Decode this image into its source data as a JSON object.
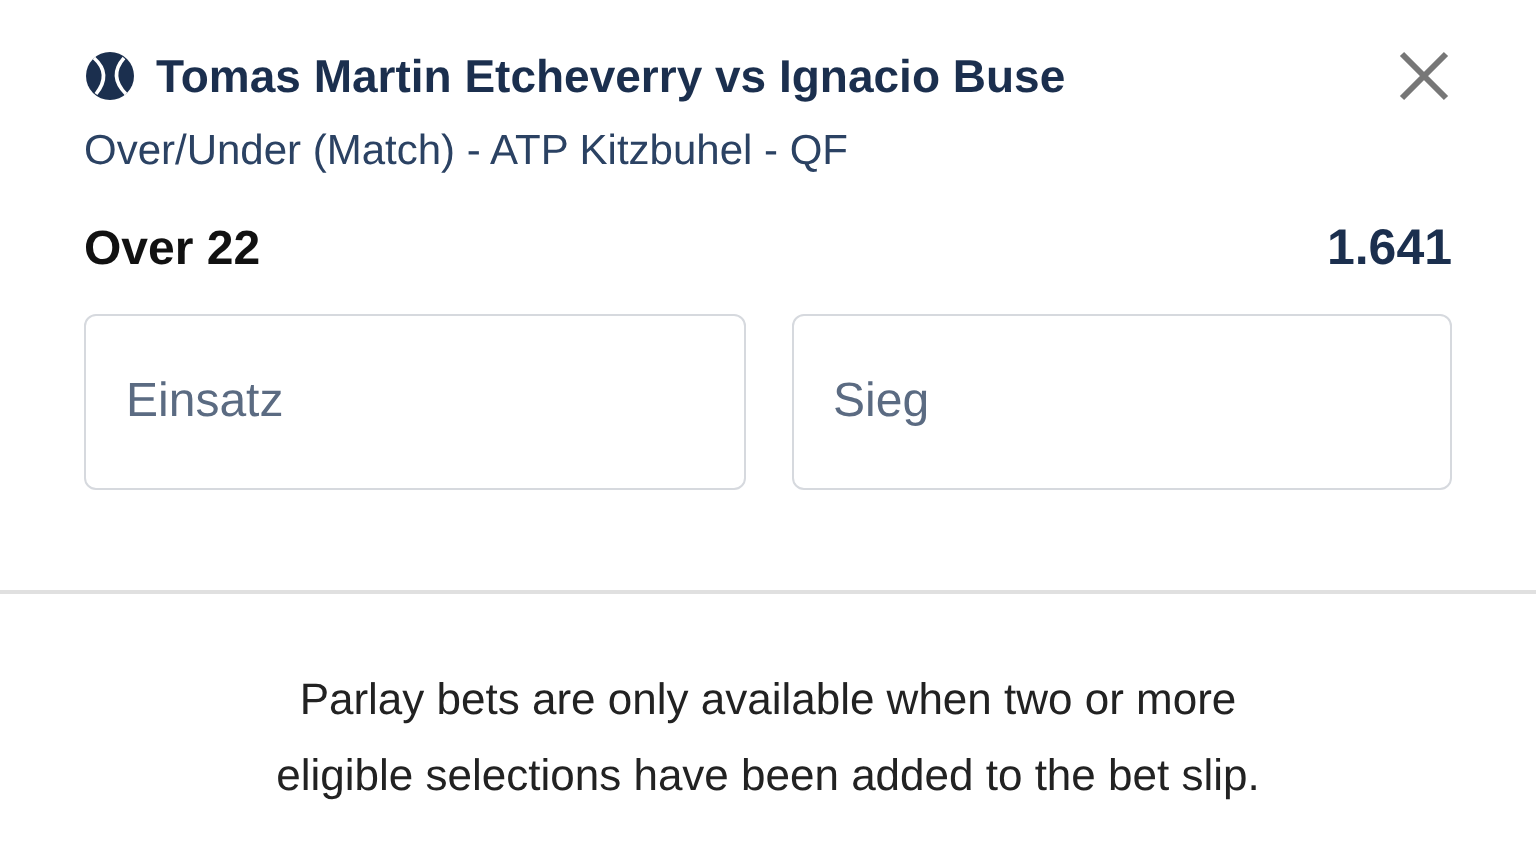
{
  "bet": {
    "match": "Tomas Martin Etcheverry vs Ignacio Buse",
    "market": "Over/Under (Match) - ATP Kitzbuhel - QF",
    "selection": "Over 22",
    "odds": "1.641"
  },
  "fields": [
    {
      "placeholder": "Einsatz"
    },
    {
      "placeholder": "Sieg"
    }
  ],
  "notice": "Parlay bets are only available when two or more eligible selections have been added to the bet slip."
}
